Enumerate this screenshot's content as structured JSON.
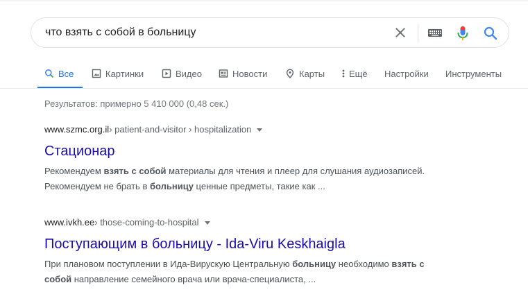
{
  "search": {
    "query": "что взять с собой в больницу",
    "clear_icon": "close-icon",
    "keyboard_icon": "keyboard-icon",
    "mic_icon": "microphone-icon",
    "search_icon": "search-icon"
  },
  "tabs": [
    {
      "label": "Все",
      "icon": "search-icon",
      "active": true
    },
    {
      "label": "Картинки",
      "icon": "image-icon"
    },
    {
      "label": "Видео",
      "icon": "video-icon"
    },
    {
      "label": "Новости",
      "icon": "news-icon"
    },
    {
      "label": "Карты",
      "icon": "map-pin-icon"
    },
    {
      "label": "Ещё",
      "icon": "more-vert-icon"
    },
    {
      "label": "Настройки"
    },
    {
      "label": "Инструменты"
    }
  ],
  "stats": "Результатов: примерно 5 410 000 (0,48 сек.)",
  "results": [
    {
      "domain": "www.szmc.org.il",
      "path": " › patient-and-visitor › hospitalization",
      "title": "Стационар",
      "snippet_line1": [
        {
          "t": "Рекомендуем ",
          "b": false
        },
        {
          "t": "взять с собой",
          "b": true
        },
        {
          "t": " материалы для чтения и плеер для слушания аудиозаписей.",
          "b": false
        }
      ],
      "snippet_line2": [
        {
          "t": "Рекомендуем не брать в ",
          "b": false
        },
        {
          "t": "больницу",
          "b": true
        },
        {
          "t": " ценные предметы, такие как ...",
          "b": false
        }
      ]
    },
    {
      "domain": "www.ivkh.ee",
      "path": " › those-coming-to-hospital",
      "title": "Поступающим в больницу - Ida-Viru Keskhaigla",
      "snippet_line1": [
        {
          "t": "При плановом поступлении в Ида-Вирускую Центральную ",
          "b": false
        },
        {
          "t": "больницу",
          "b": true
        },
        {
          "t": " необходимо ",
          "b": false
        },
        {
          "t": "взять с",
          "b": true
        }
      ],
      "snippet_line2": [
        {
          "t": "собой",
          "b": true
        },
        {
          "t": " направление семейного врача или врача-специалиста, ...",
          "b": false
        }
      ]
    }
  ],
  "colors": {
    "accent": "#1a73e8",
    "link": "#1a0dab",
    "mic_blue": "#4285f4",
    "mic_red": "#ea4335"
  }
}
